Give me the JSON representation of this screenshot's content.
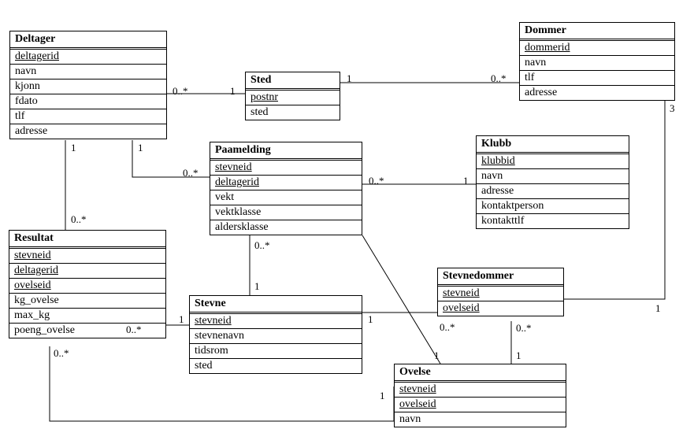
{
  "entities": {
    "deltager": {
      "title": "Deltager",
      "attrs": [
        {
          "name": "deltagerid",
          "pk": true
        },
        {
          "name": "navn",
          "pk": false
        },
        {
          "name": "kjonn",
          "pk": false
        },
        {
          "name": "fdato",
          "pk": false
        },
        {
          "name": "tlf",
          "pk": false
        },
        {
          "name": "adresse",
          "pk": false
        }
      ]
    },
    "sted": {
      "title": "Sted",
      "attrs": [
        {
          "name": "postnr",
          "pk": true
        },
        {
          "name": "sted",
          "pk": false
        }
      ]
    },
    "dommer": {
      "title": "Dommer",
      "attrs": [
        {
          "name": "dommerid",
          "pk": true
        },
        {
          "name": "navn",
          "pk": false
        },
        {
          "name": "tlf",
          "pk": false
        },
        {
          "name": "adresse",
          "pk": false
        }
      ]
    },
    "paamelding": {
      "title": "Paamelding",
      "attrs": [
        {
          "name": "stevneid",
          "pk": true
        },
        {
          "name": "deltagerid",
          "pk": true
        },
        {
          "name": "vekt",
          "pk": false
        },
        {
          "name": "vektklasse",
          "pk": false
        },
        {
          "name": "aldersklasse",
          "pk": false
        }
      ]
    },
    "klubb": {
      "title": "Klubb",
      "attrs": [
        {
          "name": "klubbid",
          "pk": true
        },
        {
          "name": "navn",
          "pk": false
        },
        {
          "name": "adresse",
          "pk": false
        },
        {
          "name": "kontaktperson",
          "pk": false
        },
        {
          "name": "kontakttlf",
          "pk": false
        }
      ]
    },
    "resultat": {
      "title": "Resultat",
      "attrs": [
        {
          "name": "stevneid",
          "pk": true
        },
        {
          "name": "deltagerid",
          "pk": true
        },
        {
          "name": "ovelseid",
          "pk": true
        },
        {
          "name": "kg_ovelse",
          "pk": false
        },
        {
          "name": "max_kg",
          "pk": false
        },
        {
          "name": "poeng_ovelse",
          "pk": false
        }
      ]
    },
    "stevne": {
      "title": "Stevne",
      "attrs": [
        {
          "name": "stevneid",
          "pk": true
        },
        {
          "name": "stevnenavn",
          "pk": false
        },
        {
          "name": "tidsrom",
          "pk": false
        },
        {
          "name": "sted",
          "pk": false
        }
      ]
    },
    "stevnedommer": {
      "title": "Stevnedommer",
      "attrs": [
        {
          "name": "stevneid",
          "pk": true
        },
        {
          "name": "ovelseid",
          "pk": true
        }
      ]
    },
    "ovelse": {
      "title": "Ovelse",
      "attrs": [
        {
          "name": "stevneid",
          "pk": true
        },
        {
          "name": "ovelseid",
          "pk": true
        },
        {
          "name": "navn",
          "pk": false
        }
      ]
    }
  },
  "multiplicities": {
    "zero_many": "0..*",
    "one": "1",
    "three": "3"
  },
  "relationships": [
    {
      "from": "Deltager",
      "to": "Sted",
      "from_mult": "0..*",
      "to_mult": "1"
    },
    {
      "from": "Sted",
      "to": "Dommer",
      "from_mult": "1",
      "to_mult": "0..*"
    },
    {
      "from": "Deltager",
      "to": "Paamelding",
      "from_mult": "1",
      "to_mult": "0..*"
    },
    {
      "from": "Deltager",
      "to": "Resultat",
      "from_mult": "1",
      "to_mult": "0..*"
    },
    {
      "from": "Paamelding",
      "to": "Klubb",
      "from_mult": "0..*",
      "to_mult": "1"
    },
    {
      "from": "Paamelding",
      "to": "Stevne",
      "from_mult": "0..*",
      "to_mult": "1"
    },
    {
      "from": "Paamelding",
      "to": "Ovelse",
      "from_mult": "0..*",
      "to_mult": "1"
    },
    {
      "from": "Resultat",
      "to": "Stevne",
      "from_mult": "0..*",
      "to_mult": "1"
    },
    {
      "from": "Resultat",
      "to": "Ovelse",
      "from_mult": "0..*",
      "to_mult": "1"
    },
    {
      "from": "Stevne",
      "to": "Stevnedommer",
      "from_mult": "1",
      "to_mult": "0..*"
    },
    {
      "from": "Stevnedommer",
      "to": "Dommer",
      "from_mult": "0..*",
      "to_mult": "3"
    },
    {
      "from": "Ovelse",
      "to": "Stevnedommer",
      "from_mult": "1",
      "to_mult": "0..*"
    }
  ]
}
